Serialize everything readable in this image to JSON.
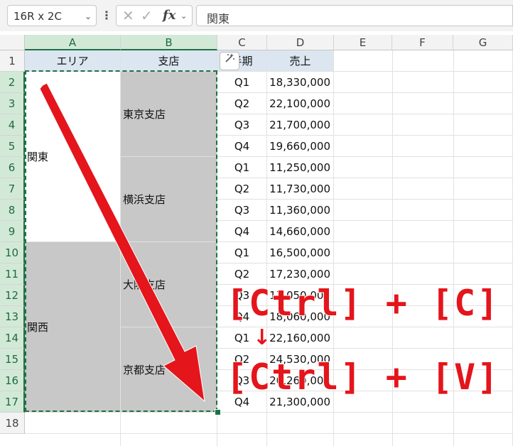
{
  "formula_bar": {
    "name_box": "16R x 2C",
    "name_box_chevron": "⌄",
    "menu_dots": "⋮",
    "cancel_icon": "✕",
    "enter_icon": "✓",
    "fx_label": "fx",
    "fx_chevron": "⌄",
    "content": "関東"
  },
  "columns": [
    "A",
    "B",
    "C",
    "D",
    "E",
    "F",
    "G"
  ],
  "rows": [
    "1",
    "2",
    "3",
    "4",
    "5",
    "6",
    "7",
    "8",
    "9",
    "10",
    "11",
    "12",
    "13",
    "14",
    "15",
    "16",
    "17",
    "18"
  ],
  "table": {
    "headers": {
      "area": "エリア",
      "branch": "支店",
      "half": "半期",
      "sales": "売上"
    },
    "area_1": "関東",
    "area_2": "関西",
    "branches": [
      "東京支店",
      "横浜支店",
      "大阪支店",
      "京都支店"
    ],
    "quarters": [
      "Q1",
      "Q2",
      "Q3",
      "Q4",
      "Q1",
      "Q2",
      "Q3",
      "Q4",
      "Q1",
      "Q2",
      "Q3",
      "Q4",
      "Q1",
      "Q2",
      "Q3",
      "Q4"
    ],
    "sales": [
      "18,330,000",
      "22,100,000",
      "21,700,000",
      "19,660,000",
      "11,250,000",
      "11,730,000",
      "11,360,000",
      "14,660,000",
      "16,500,000",
      "17,230,000",
      "17,050,000",
      "18,060,000",
      "22,160,000",
      "24,530,000",
      "20,260,000",
      "21,300,000"
    ]
  },
  "annotation": {
    "copy_keys": "[Ctrl] + [C]",
    "down_arrow": "↓",
    "paste_keys": "[Ctrl] + [V]"
  },
  "colors": {
    "selection": "#1e7145",
    "header_fill": "#dce6f1",
    "gray_fill": "#c8c8c8",
    "overlay_red": "#e4151b"
  },
  "icons": {
    "quick_analysis": "quick-analysis-icon"
  }
}
